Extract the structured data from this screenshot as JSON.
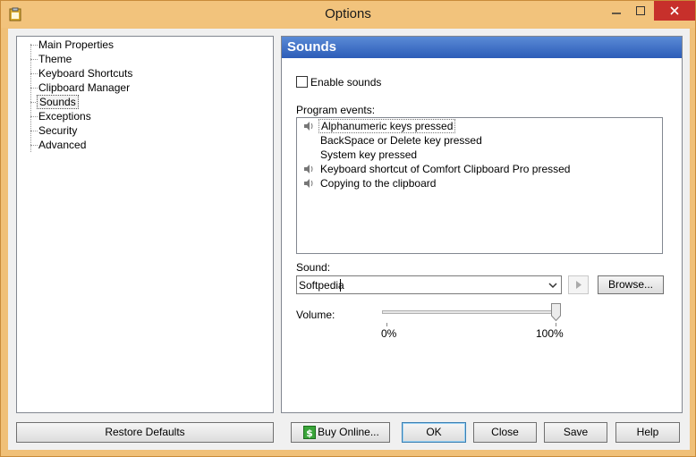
{
  "window": {
    "title": "Options"
  },
  "sidebar": {
    "items": [
      {
        "label": "Main Properties"
      },
      {
        "label": "Theme"
      },
      {
        "label": "Keyboard Shortcuts"
      },
      {
        "label": "Clipboard Manager"
      },
      {
        "label": "Sounds",
        "selected": true
      },
      {
        "label": "Exceptions"
      },
      {
        "label": "Security"
      },
      {
        "label": "Advanced"
      }
    ]
  },
  "panel": {
    "title": "Sounds",
    "enable_sounds_label": "Enable sounds",
    "enable_sounds_checked": false,
    "events_label": "Program events:",
    "events": [
      {
        "label": "Alphanumeric keys pressed",
        "has_sound": true,
        "selected": true
      },
      {
        "label": "BackSpace or Delete key pressed",
        "has_sound": false
      },
      {
        "label": "System key pressed",
        "has_sound": false
      },
      {
        "label": "Keyboard shortcut of Comfort Clipboard Pro pressed",
        "has_sound": true
      },
      {
        "label": "Copying to the clipboard",
        "has_sound": true
      }
    ],
    "sound_label": "Sound:",
    "sound_value": "Softpedia",
    "browse_label": "Browse...",
    "volume_label": "Volume:",
    "volume_min_label": "0%",
    "volume_max_label": "100%",
    "volume_value": 1.0
  },
  "footer": {
    "restore_defaults": "Restore Defaults",
    "buy_online": "Buy Online...",
    "ok": "OK",
    "close": "Close",
    "save": "Save",
    "help": "Help"
  },
  "colors": {
    "accent_header": "#2c5cb8",
    "titlebar": "#f2c37c",
    "close_button": "#c7302b"
  }
}
